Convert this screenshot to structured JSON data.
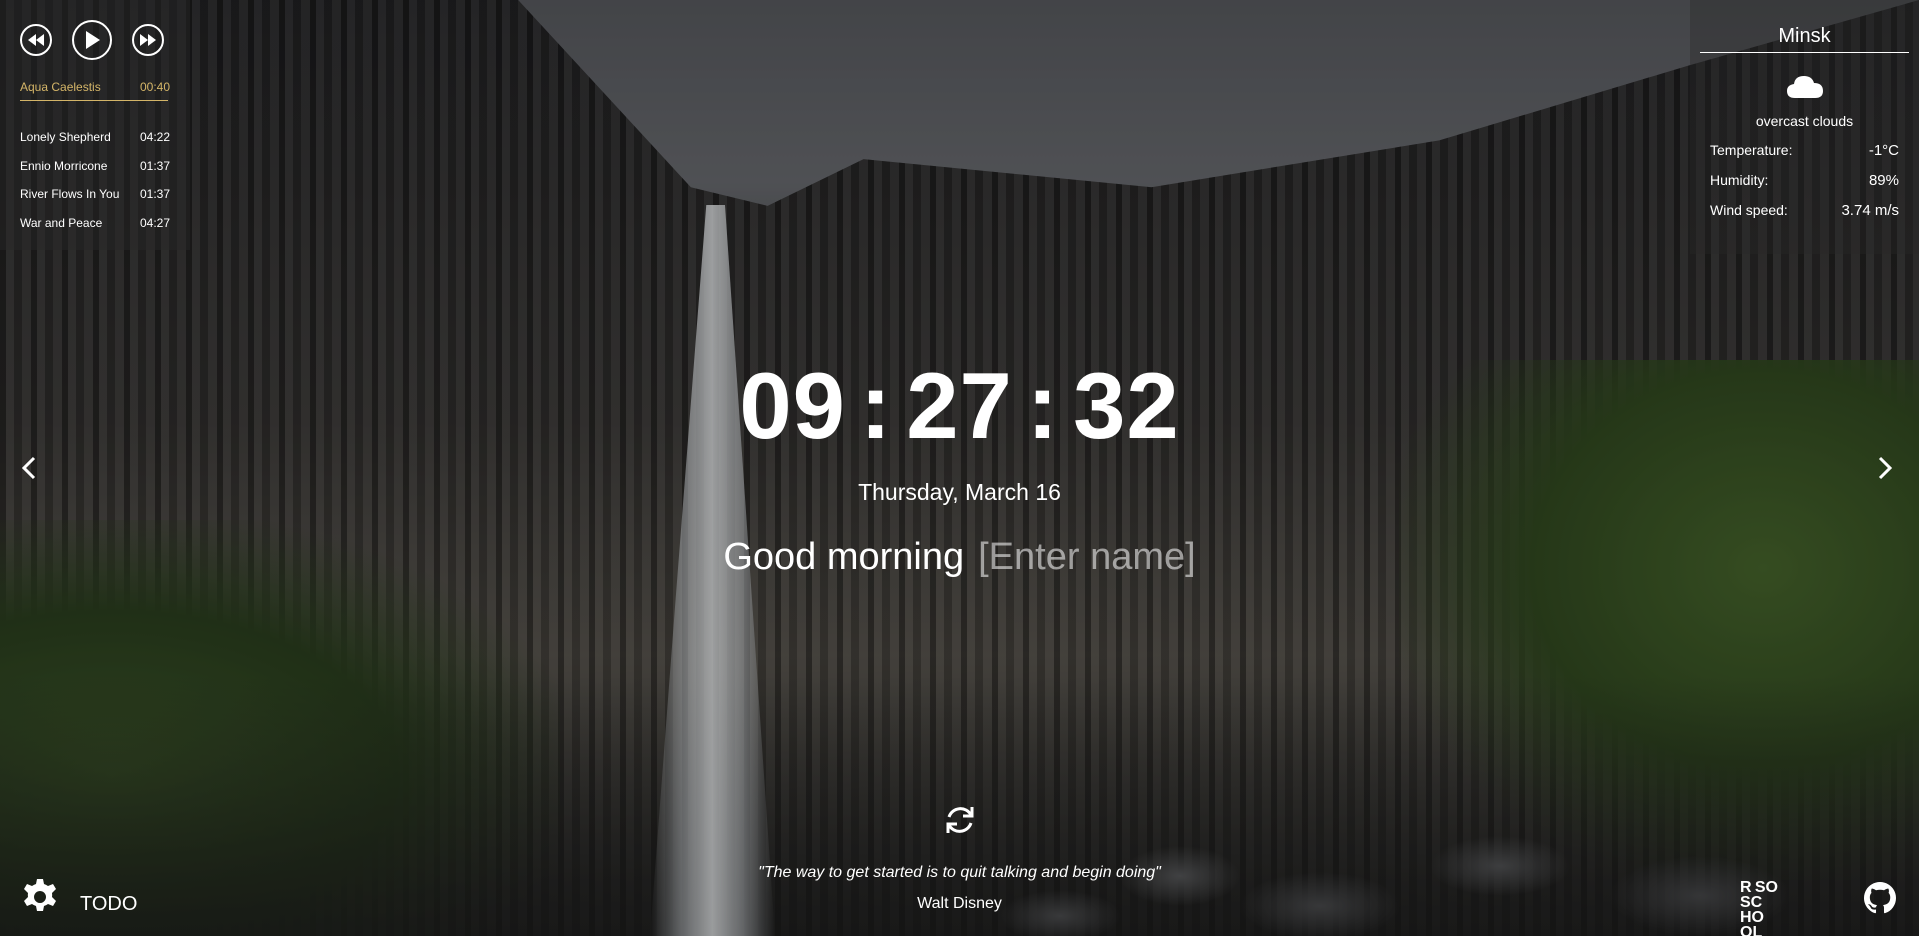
{
  "player": {
    "now_playing": {
      "title": "Aqua Caelestis",
      "time": "00:40"
    },
    "playlist": [
      {
        "title": "Lonely Shepherd",
        "duration": "04:22"
      },
      {
        "title": "Ennio Morricone",
        "duration": "01:37"
      },
      {
        "title": "River Flows In You",
        "duration": "01:37"
      },
      {
        "title": "War and Peace",
        "duration": "04:27"
      }
    ],
    "accent_color": "#d4b568"
  },
  "weather": {
    "city": "Minsk",
    "icon": "cloud-icon",
    "description": "overcast clouds",
    "temperature_label": "Temperature:",
    "temperature_value": "-1°C",
    "humidity_label": "Humidity:",
    "humidity_value": "89%",
    "wind_label": "Wind speed:",
    "wind_value": "3.74 m/s"
  },
  "clock": {
    "hours": "09",
    "minutes": "27",
    "seconds": "32",
    "separator": ":"
  },
  "date": "Thursday, March 16",
  "greeting": {
    "text": "Good morning",
    "name_placeholder": "[Enter name]"
  },
  "quote": {
    "text": "\"The way to get started is to quit talking and begin doing\"",
    "author": "Walt Disney"
  },
  "footer": {
    "todo_label": "TODO",
    "rss_line1_left": "R",
    "rss_line1_right": "S",
    "rss_line1_small": "O",
    "rss_line2": "SC HO OL"
  }
}
